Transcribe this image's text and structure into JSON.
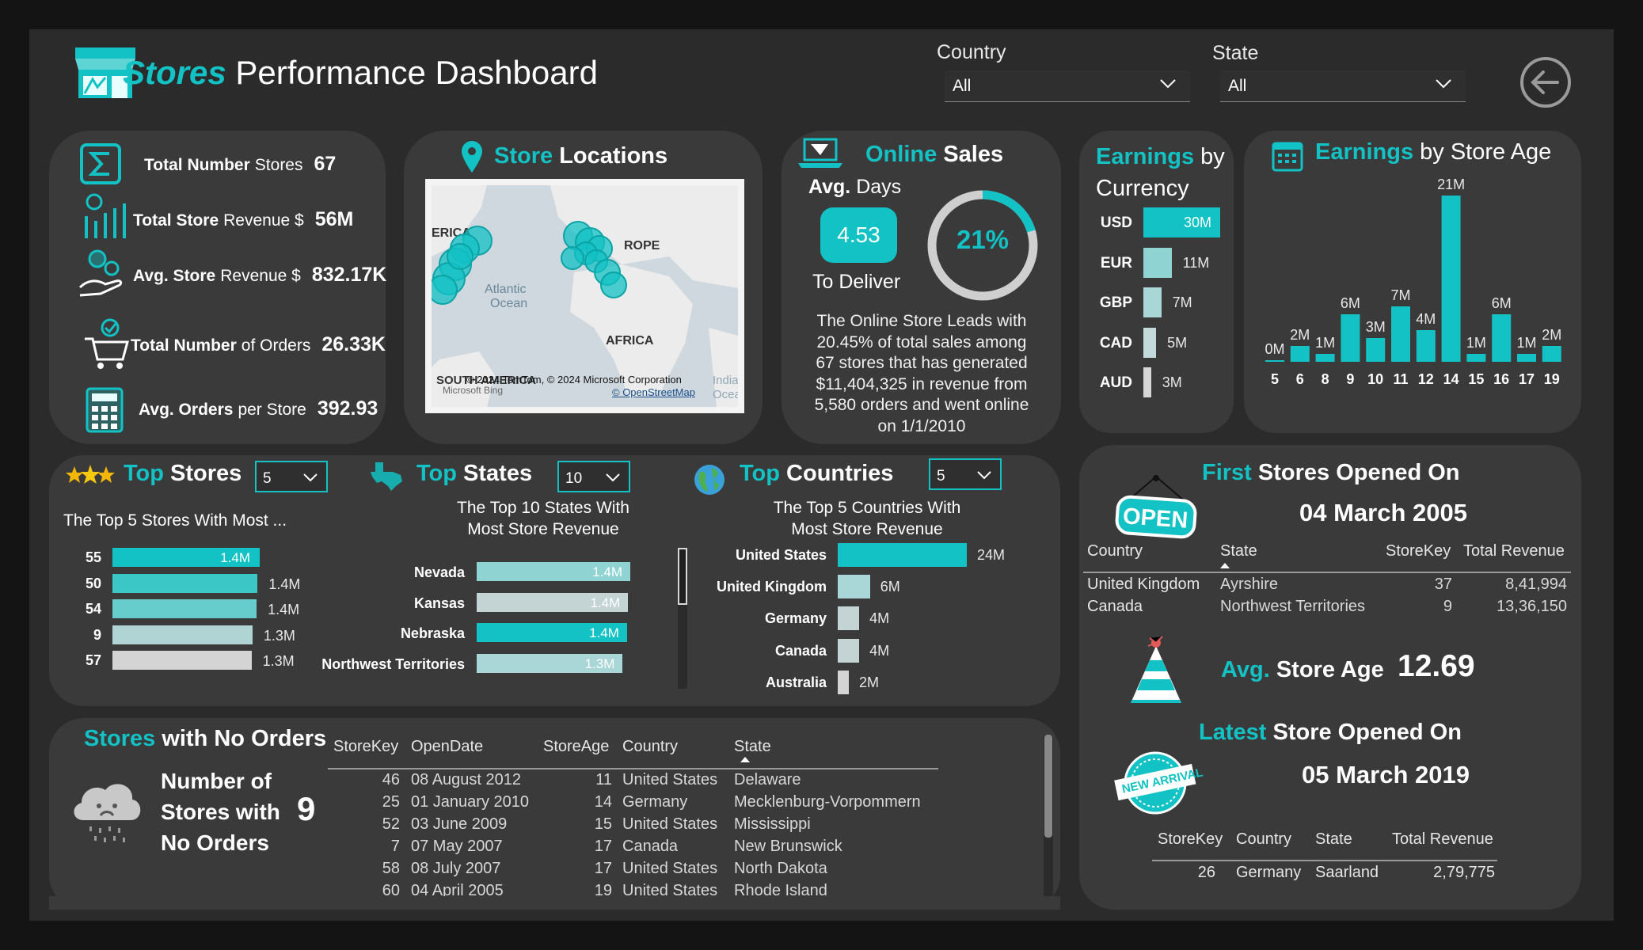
{
  "header": {
    "title_accent": "Stores",
    "title_rest": " Performance Dashboard",
    "filters": [
      {
        "label": "Country",
        "value": "All"
      },
      {
        "label": "State",
        "value": "All"
      }
    ]
  },
  "kpis": {
    "total_stores": {
      "label_b": "Total Number",
      "label": " Stores",
      "value": "67"
    },
    "total_revenue": {
      "label_b": "Total Store",
      "label": " Revenue $",
      "value": "56M"
    },
    "avg_revenue": {
      "label_b": "Avg. Store",
      "label": " Revenue $",
      "value": "832.17K"
    },
    "total_orders": {
      "label_b": "Total Number",
      "label": " of Orders",
      "value": "26.33K"
    },
    "avg_orders": {
      "label_b": "Avg. Orders",
      "label": " per Store",
      "value": "392.93"
    }
  },
  "store_locations": {
    "title_accent": "Store",
    "title_rest": " Locations",
    "map_labels": [
      "ERICA",
      "ROPE",
      "Atlantic",
      "Ocean",
      "AFRICA",
      "SOUTH AMERICA",
      "India",
      "Ocea"
    ],
    "attribution": "© 2024 TomTom, © 2024 Microsoft Corporation",
    "osm": "© OpenStreetMap",
    "bing": "Microsoft Bing"
  },
  "online_sales": {
    "title_accent": "Online",
    "title_rest": " Sales",
    "avg_label_b": "Avg.",
    "avg_label": " Days",
    "avg_days": "4.53",
    "to_deliver": "To Deliver",
    "pct": "21%",
    "pct_value": 0.2045,
    "desc": [
      "The Online Store Leads with",
      "20.45% of total sales among",
      "67 stores that has generated",
      "$11,404,325 in revenue from",
      "5,580 orders and went online",
      "on 1/1/2010"
    ]
  },
  "earnings_currency": {
    "title_accent": "Earnings",
    "title_rest": " by",
    "title_line2": "Currency",
    "rows": [
      {
        "code": "USD",
        "label": "30M",
        "value": 30,
        "color": "#12c2c4"
      },
      {
        "code": "EUR",
        "label": "11M",
        "value": 11,
        "color": "#8fd3d3"
      },
      {
        "code": "GBP",
        "label": "7M",
        "value": 7,
        "color": "#a9d6d6"
      },
      {
        "code": "CAD",
        "label": "5M",
        "value": 5,
        "color": "#c4dada"
      },
      {
        "code": "AUD",
        "label": "3M",
        "value": 3,
        "color": "#d6d6d6"
      }
    ]
  },
  "chart_data": {
    "type": "bar",
    "title": "Earnings by Store Age",
    "categories": [
      "5",
      "6",
      "8",
      "9",
      "10",
      "11",
      "12",
      "14",
      "15",
      "16",
      "17",
      "19"
    ],
    "values": [
      0.2,
      2,
      1,
      6,
      3,
      7,
      4,
      21,
      1,
      6,
      1,
      2
    ],
    "labels": [
      "0M",
      "2M",
      "1M",
      "6M",
      "3M",
      "7M",
      "4M",
      "21M",
      "1M",
      "6M",
      "1M",
      "2M"
    ],
    "ylim": [
      0,
      21
    ]
  },
  "top_stores": {
    "title_accent": "Top",
    "title_rest": " Stores",
    "select": "5",
    "subtitle": "The Top 5 Stores With Most ...",
    "rows": [
      {
        "key": "55",
        "label": "1.4M",
        "value": 1.43,
        "color": "#12c2c4",
        "inside": true
      },
      {
        "key": "50",
        "label": "1.4M",
        "value": 1.41,
        "color": "#3cc7c7",
        "inside": false
      },
      {
        "key": "54",
        "label": "1.4M",
        "value": 1.4,
        "color": "#66cccc",
        "inside": false
      },
      {
        "key": "9",
        "label": "1.3M",
        "value": 1.36,
        "color": "#b0d4d4",
        "inside": false
      },
      {
        "key": "57",
        "label": "1.3M",
        "value": 1.35,
        "color": "#d4d4d4",
        "inside": false
      }
    ]
  },
  "top_states": {
    "title_accent": "Top",
    "title_rest": " States",
    "select": "10",
    "subtitle": [
      "The Top 10 States With",
      "Most Store Revenue"
    ],
    "rows": [
      {
        "name": "Nevada",
        "label": "1.4M",
        "value": 1.41,
        "color": "#8fd3d3"
      },
      {
        "name": "Kansas",
        "label": "1.4M",
        "value": 1.39,
        "color": "#c4d4d4"
      },
      {
        "name": "Nebraska",
        "label": "1.4M",
        "value": 1.38,
        "color": "#12c2c4"
      },
      {
        "name": "Northwest Territories",
        "label": "1.3M",
        "value": 1.34,
        "color": "#a9d6d6"
      }
    ]
  },
  "top_countries": {
    "title_accent": "Top",
    "title_rest": " Countries",
    "select": "5",
    "subtitle": [
      "The Top 5 Countries With",
      "Most Store Revenue"
    ],
    "rows": [
      {
        "name": "United States",
        "label": "24M",
        "value": 24,
        "color": "#12c2c4"
      },
      {
        "name": "United Kingdom",
        "label": "6M",
        "value": 6,
        "color": "#a9d6d6"
      },
      {
        "name": "Germany",
        "label": "4M",
        "value": 4,
        "color": "#c4d4d4"
      },
      {
        "name": "Canada",
        "label": "4M",
        "value": 4,
        "color": "#c4d4d4"
      },
      {
        "name": "Australia",
        "label": "2M",
        "value": 2,
        "color": "#d4d4d4"
      }
    ]
  },
  "no_orders": {
    "title_accent": "Stores",
    "title_rest": " with No Orders",
    "card_text": [
      "Number of",
      "Stores with",
      "No Orders"
    ],
    "count": "9",
    "columns": [
      "StoreKey",
      "OpenDate",
      "StoreAge",
      "Country",
      "State"
    ],
    "rows": [
      [
        "46",
        "08 August 2012",
        "11",
        "United States",
        "Delaware"
      ],
      [
        "25",
        "01 January 2010",
        "14",
        "Germany",
        "Mecklenburg-Vorpommern"
      ],
      [
        "52",
        "03 June 2009",
        "15",
        "United States",
        "Mississippi"
      ],
      [
        "7",
        "07 May 2007",
        "17",
        "Canada",
        "New Brunswick"
      ],
      [
        "58",
        "08 July 2007",
        "17",
        "United States",
        "North Dakota"
      ],
      [
        "60",
        "04 April 2005",
        "19",
        "United States",
        "Rhode Island"
      ]
    ]
  },
  "first_stores": {
    "title_accent": "First",
    "title_rest": " Stores Opened On",
    "date": "04 March 2005",
    "sign": "OPEN",
    "columns": [
      "Country",
      "State",
      "StoreKey",
      "Total Revenue"
    ],
    "rows": [
      [
        "United Kingdom",
        "Ayrshire",
        "37",
        "8,41,994"
      ],
      [
        "Canada",
        "Northwest Territories",
        "9",
        "13,36,150"
      ]
    ]
  },
  "avg_age": {
    "label_accent": "Avg.",
    "label_rest": " Store Age",
    "value": "12.69"
  },
  "latest_store": {
    "title_accent": "Latest",
    "title_rest": " Store Opened On",
    "date": "05 March 2019",
    "badge": "NEW ARRIVAL",
    "columns": [
      "StoreKey",
      "Country",
      "State",
      "Total Revenue"
    ],
    "row": [
      "26",
      "Germany",
      "Saarland",
      "2,79,775"
    ]
  }
}
